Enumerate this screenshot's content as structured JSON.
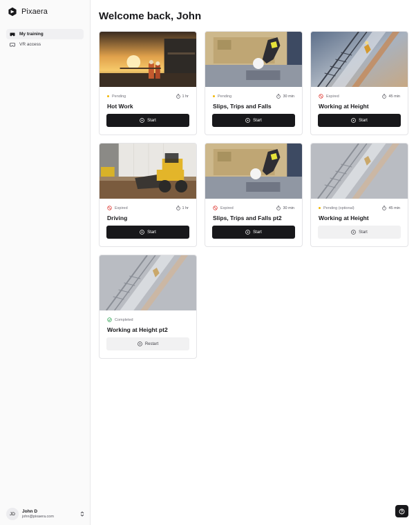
{
  "brand": {
    "name": "Pixaera",
    "logo_icon": "pixaera-logo-icon"
  },
  "sidebar": {
    "items": [
      {
        "label": "My training",
        "icon": "vr-headset-icon",
        "active": true
      },
      {
        "label": "VR access",
        "icon": "headset-outline-icon",
        "active": false
      }
    ]
  },
  "user": {
    "initials": "JD",
    "name": "John D",
    "email": "john@pixaera.com",
    "toggle_icon": "chevron-up-down-icon"
  },
  "main": {
    "title": "Welcome back, John"
  },
  "colors": {
    "pending_dot": "#f2b705",
    "expired": "#e0413b",
    "completed": "#3aa85c",
    "primary_button": "#18181b",
    "secondary_button": "#f1f1f2"
  },
  "cards": [
    {
      "title": "Hot Work",
      "status": "Pending",
      "status_type": "pending",
      "duration": "1 hr",
      "button": "Start",
      "button_style": "primary",
      "image": "sunset-industrial-site"
    },
    {
      "title": "Slips, Trips and Falls",
      "status": "Pending",
      "status_type": "pending",
      "duration": "30 min",
      "button": "Start",
      "button_style": "primary",
      "image": "worker-falling"
    },
    {
      "title": "Working at Height",
      "status": "Expired",
      "status_type": "expired",
      "duration": "45 min",
      "button": "Start",
      "button_style": "primary",
      "image": "ladder-height"
    },
    {
      "title": "Driving",
      "status": "Expired",
      "status_type": "expired",
      "duration": "1 hr",
      "button": "Start",
      "button_style": "primary",
      "image": "yellow-loader"
    },
    {
      "title": "Slips, Trips and Falls pt2",
      "status": "Expired",
      "status_type": "expired",
      "duration": "30 min",
      "button": "Start",
      "button_style": "primary",
      "image": "worker-falling"
    },
    {
      "title": "Working at Height",
      "status": "Pending (optional)",
      "status_type": "pending",
      "duration": "45 min",
      "button": "Start",
      "button_style": "secondary",
      "image": "ladder-height-faded"
    },
    {
      "title": "Working at Height pt2",
      "status": "Completed",
      "status_type": "completed",
      "duration": "",
      "button": "Restart",
      "button_style": "secondary",
      "image": "ladder-height-faded"
    }
  ],
  "help": {
    "icon": "help-icon"
  }
}
